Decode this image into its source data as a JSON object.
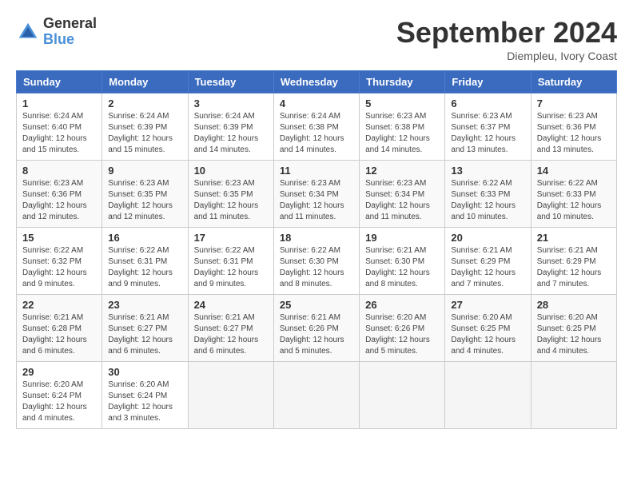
{
  "header": {
    "logo_general": "General",
    "logo_blue": "Blue",
    "month_title": "September 2024",
    "location": "Diempleu, Ivory Coast"
  },
  "weekdays": [
    "Sunday",
    "Monday",
    "Tuesday",
    "Wednesday",
    "Thursday",
    "Friday",
    "Saturday"
  ],
  "weeks": [
    [
      {
        "day": "1",
        "sunrise": "6:24 AM",
        "sunset": "6:40 PM",
        "daylight": "12 hours and 15 minutes."
      },
      {
        "day": "2",
        "sunrise": "6:24 AM",
        "sunset": "6:39 PM",
        "daylight": "12 hours and 15 minutes."
      },
      {
        "day": "3",
        "sunrise": "6:24 AM",
        "sunset": "6:39 PM",
        "daylight": "12 hours and 14 minutes."
      },
      {
        "day": "4",
        "sunrise": "6:24 AM",
        "sunset": "6:38 PM",
        "daylight": "12 hours and 14 minutes."
      },
      {
        "day": "5",
        "sunrise": "6:23 AM",
        "sunset": "6:38 PM",
        "daylight": "12 hours and 14 minutes."
      },
      {
        "day": "6",
        "sunrise": "6:23 AM",
        "sunset": "6:37 PM",
        "daylight": "12 hours and 13 minutes."
      },
      {
        "day": "7",
        "sunrise": "6:23 AM",
        "sunset": "6:36 PM",
        "daylight": "12 hours and 13 minutes."
      }
    ],
    [
      {
        "day": "8",
        "sunrise": "6:23 AM",
        "sunset": "6:36 PM",
        "daylight": "12 hours and 12 minutes."
      },
      {
        "day": "9",
        "sunrise": "6:23 AM",
        "sunset": "6:35 PM",
        "daylight": "12 hours and 12 minutes."
      },
      {
        "day": "10",
        "sunrise": "6:23 AM",
        "sunset": "6:35 PM",
        "daylight": "12 hours and 11 minutes."
      },
      {
        "day": "11",
        "sunrise": "6:23 AM",
        "sunset": "6:34 PM",
        "daylight": "12 hours and 11 minutes."
      },
      {
        "day": "12",
        "sunrise": "6:23 AM",
        "sunset": "6:34 PM",
        "daylight": "12 hours and 11 minutes."
      },
      {
        "day": "13",
        "sunrise": "6:22 AM",
        "sunset": "6:33 PM",
        "daylight": "12 hours and 10 minutes."
      },
      {
        "day": "14",
        "sunrise": "6:22 AM",
        "sunset": "6:33 PM",
        "daylight": "12 hours and 10 minutes."
      }
    ],
    [
      {
        "day": "15",
        "sunrise": "6:22 AM",
        "sunset": "6:32 PM",
        "daylight": "12 hours and 9 minutes."
      },
      {
        "day": "16",
        "sunrise": "6:22 AM",
        "sunset": "6:31 PM",
        "daylight": "12 hours and 9 minutes."
      },
      {
        "day": "17",
        "sunrise": "6:22 AM",
        "sunset": "6:31 PM",
        "daylight": "12 hours and 9 minutes."
      },
      {
        "day": "18",
        "sunrise": "6:22 AM",
        "sunset": "6:30 PM",
        "daylight": "12 hours and 8 minutes."
      },
      {
        "day": "19",
        "sunrise": "6:21 AM",
        "sunset": "6:30 PM",
        "daylight": "12 hours and 8 minutes."
      },
      {
        "day": "20",
        "sunrise": "6:21 AM",
        "sunset": "6:29 PM",
        "daylight": "12 hours and 7 minutes."
      },
      {
        "day": "21",
        "sunrise": "6:21 AM",
        "sunset": "6:29 PM",
        "daylight": "12 hours and 7 minutes."
      }
    ],
    [
      {
        "day": "22",
        "sunrise": "6:21 AM",
        "sunset": "6:28 PM",
        "daylight": "12 hours and 6 minutes."
      },
      {
        "day": "23",
        "sunrise": "6:21 AM",
        "sunset": "6:27 PM",
        "daylight": "12 hours and 6 minutes."
      },
      {
        "day": "24",
        "sunrise": "6:21 AM",
        "sunset": "6:27 PM",
        "daylight": "12 hours and 6 minutes."
      },
      {
        "day": "25",
        "sunrise": "6:21 AM",
        "sunset": "6:26 PM",
        "daylight": "12 hours and 5 minutes."
      },
      {
        "day": "26",
        "sunrise": "6:20 AM",
        "sunset": "6:26 PM",
        "daylight": "12 hours and 5 minutes."
      },
      {
        "day": "27",
        "sunrise": "6:20 AM",
        "sunset": "6:25 PM",
        "daylight": "12 hours and 4 minutes."
      },
      {
        "day": "28",
        "sunrise": "6:20 AM",
        "sunset": "6:25 PM",
        "daylight": "12 hours and 4 minutes."
      }
    ],
    [
      {
        "day": "29",
        "sunrise": "6:20 AM",
        "sunset": "6:24 PM",
        "daylight": "12 hours and 4 minutes."
      },
      {
        "day": "30",
        "sunrise": "6:20 AM",
        "sunset": "6:24 PM",
        "daylight": "12 hours and 3 minutes."
      },
      null,
      null,
      null,
      null,
      null
    ]
  ]
}
